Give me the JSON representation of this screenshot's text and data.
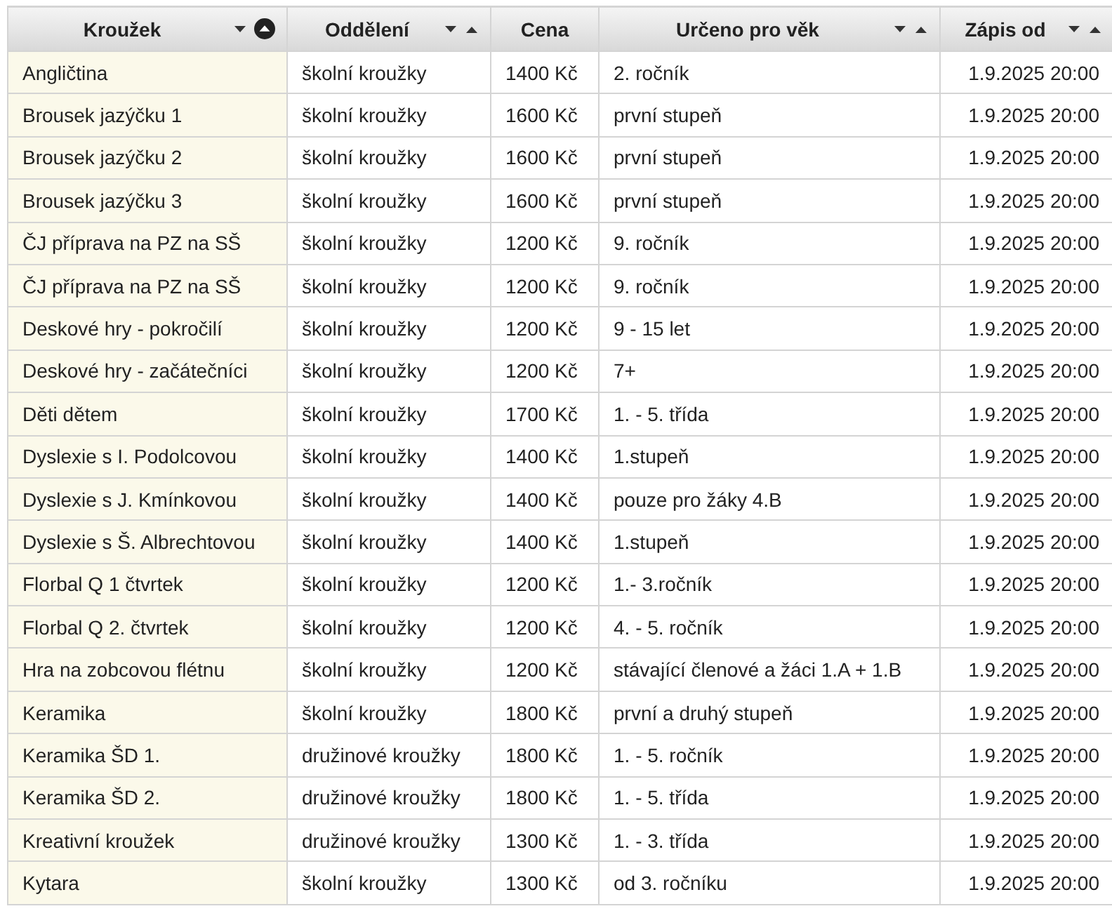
{
  "table": {
    "columns": [
      {
        "label": "Kroužek",
        "sortable": true,
        "sorted": true
      },
      {
        "label": "Oddělení",
        "sortable": true,
        "sorted": false
      },
      {
        "label": "Cena",
        "sortable": false
      },
      {
        "label": "Určeno pro věk",
        "sortable": true,
        "sorted": false
      },
      {
        "label": "Zápis od",
        "sortable": true,
        "sorted": false
      }
    ],
    "rows": [
      [
        "Angličtina",
        "školní kroužky",
        "1400 Kč",
        "2. ročník",
        "1.9.2025 20:00"
      ],
      [
        "Brousek jazýčku 1",
        "školní kroužky",
        "1600 Kč",
        "první stupeň",
        "1.9.2025 20:00"
      ],
      [
        "Brousek jazýčku 2",
        "školní kroužky",
        "1600 Kč",
        "první stupeň",
        "1.9.2025 20:00"
      ],
      [
        "Brousek jazýčku 3",
        "školní kroužky",
        "1600 Kč",
        "první stupeň",
        "1.9.2025 20:00"
      ],
      [
        "ČJ příprava na PZ na SŠ",
        "školní kroužky",
        "1200 Kč",
        "9. ročník",
        "1.9.2025 20:00"
      ],
      [
        "ČJ příprava na PZ na SŠ",
        "školní kroužky",
        "1200 Kč",
        "9. ročník",
        "1.9.2025 20:00"
      ],
      [
        "Deskové hry - pokročilí",
        "školní kroužky",
        "1200 Kč",
        "9 - 15 let",
        "1.9.2025 20:00"
      ],
      [
        "Deskové hry - začátečníci",
        "školní kroužky",
        "1200 Kč",
        "7+",
        "1.9.2025 20:00"
      ],
      [
        "Děti dětem",
        "školní kroužky",
        "1700 Kč",
        "1. - 5. třída",
        "1.9.2025 20:00"
      ],
      [
        "Dyslexie s I. Podolcovou",
        "školní kroužky",
        "1400 Kč",
        "1.stupeň",
        "1.9.2025 20:00"
      ],
      [
        "Dyslexie s J. Kmínkovou",
        "školní kroužky",
        "1400 Kč",
        "pouze pro žáky 4.B",
        "1.9.2025 20:00"
      ],
      [
        "Dyslexie s Š. Albrechtovou",
        "školní kroužky",
        "1400 Kč",
        "1.stupeň",
        "1.9.2025 20:00"
      ],
      [
        "Florbal Q 1 čtvrtek",
        "školní kroužky",
        "1200 Kč",
        "1.- 3.ročník",
        "1.9.2025 20:00"
      ],
      [
        "Florbal Q 2. čtvrtek",
        "školní kroužky",
        "1200 Kč",
        "4. - 5. ročník",
        "1.9.2025 20:00"
      ],
      [
        "Hra na zobcovou flétnu",
        "školní kroužky",
        "1200 Kč",
        "stávající členové a žáci 1.A + 1.B",
        "1.9.2025 20:00"
      ],
      [
        "Keramika",
        "školní kroužky",
        "1800 Kč",
        "první a druhý stupeň",
        "1.9.2025 20:00"
      ],
      [
        "Keramika ŠD 1.",
        "družinové kroužky",
        "1800 Kč",
        "1. - 5. ročník",
        "1.9.2025 20:00"
      ],
      [
        "Keramika ŠD 2.",
        "družinové kroužky",
        "1800 Kč",
        "1. - 5. třída",
        "1.9.2025 20:00"
      ],
      [
        "Kreativní kroužek",
        "družinové kroužky",
        "1300 Kč",
        "1. - 3. třída",
        "1.9.2025 20:00"
      ],
      [
        "Kytara",
        "školní kroužky",
        "1300 Kč",
        "od 3. ročníku",
        "1.9.2025 20:00"
      ]
    ]
  }
}
